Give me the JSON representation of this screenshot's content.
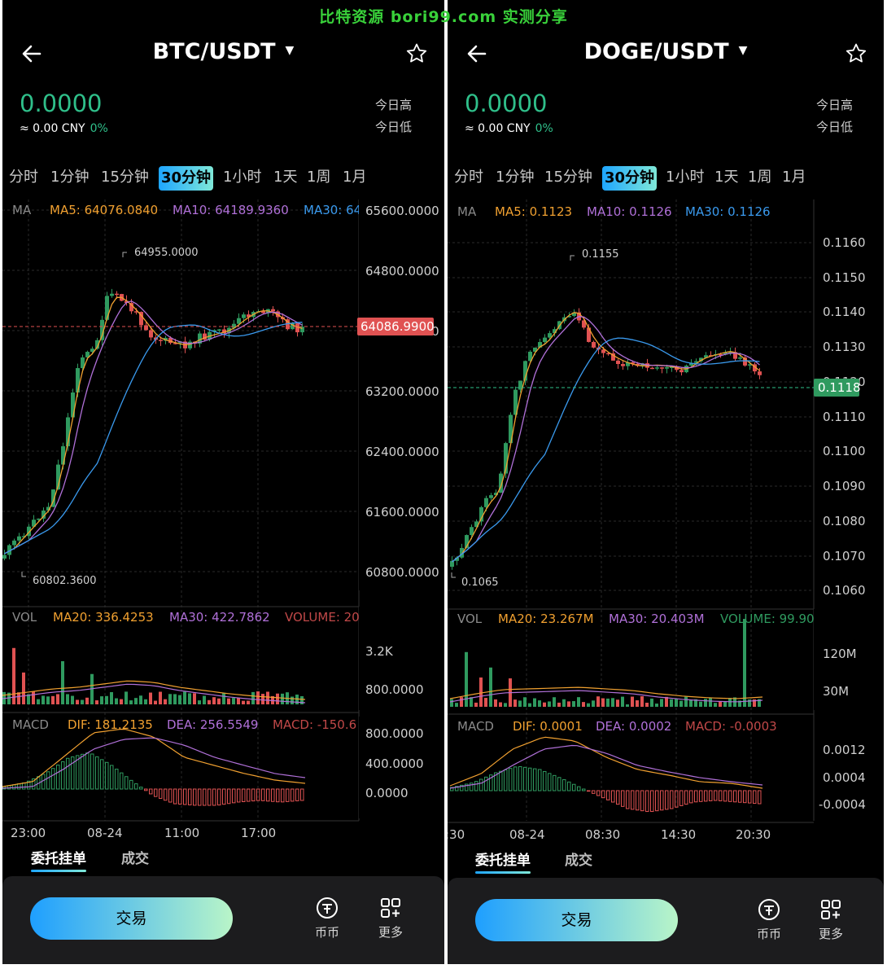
{
  "watermark": "比特资源  bori99.com  实测分享",
  "colors": {
    "up": "#2f9a5f",
    "down": "#e05252",
    "ma5": "#f0a030",
    "ma10": "#b070d8",
    "ma30": "#3a9aee",
    "accent": "#2fbf8a",
    "background": "#000000"
  },
  "panels": [
    {
      "pair": "BTC/USDT",
      "price": "0.0000",
      "cny": "≈ 0.00 CNY",
      "change": "0%",
      "today_high": "今日高",
      "today_low": "今日低",
      "timeframes": [
        "分时",
        "1分钟",
        "15分钟",
        "30分钟",
        "1小时",
        "1天",
        "1周",
        "1月"
      ],
      "active_timeframe": "30分钟",
      "ma_label": "MA",
      "ma5": "MA5: 64076.0840",
      "ma10": "MA10: 64189.9360",
      "ma30": "MA30: 64",
      "y_ticks": [
        "65600.0000",
        "64800.0000",
        "64000.0000",
        "63200.0000",
        "62400.0000",
        "61600.0000",
        "60800.0000"
      ],
      "current_price_label": "64086.9900",
      "max_label": "64955.0000",
      "min_label": "60802.3600",
      "vol_label": "VOL",
      "vol_ma20": "MA20: 336.4253",
      "vol_ma30": "MA30: 422.7862",
      "vol_volume": "VOLUME: 20",
      "vol_ticks": [
        "3.2K",
        "800.0000"
      ],
      "macd_label": "MACD",
      "dif": "DIF: 181.2135",
      "dea": "DEA: 256.5549",
      "macd": "MACD: -150.6",
      "macd_ticks": [
        "800.0000",
        "400.0000",
        "0.0000"
      ],
      "x_ticks": [
        "23:00",
        "08-24",
        "11:00",
        "17:00"
      ],
      "order_tab": "委托挂单",
      "deal_tab": "成交",
      "trade_button": "交易",
      "coin_label": "币币",
      "more_label": "更多"
    },
    {
      "pair": "DOGE/USDT",
      "price": "0.0000",
      "cny": "≈ 0.00 CNY",
      "change": "0%",
      "today_high": "今日高",
      "today_low": "今日低",
      "timeframes": [
        "分时",
        "1分钟",
        "15分钟",
        "30分钟",
        "1小时",
        "1天",
        "1周",
        "1月"
      ],
      "active_timeframe": "30分钟",
      "ma_label": "MA",
      "ma5": "MA5: 0.1123",
      "ma10": "MA10: 0.1126",
      "ma30": "MA30: 0.1126",
      "y_ticks": [
        "0.1160",
        "0.1150",
        "0.1140",
        "0.1130",
        "0.1120",
        "0.1110",
        "0.1100",
        "0.1090",
        "0.1080",
        "0.1070",
        "0.1060"
      ],
      "current_price_label": "0.1118",
      "max_label": "0.1155",
      "min_label": "0.1065",
      "vol_label": "VOL",
      "vol_ma20": "MA20: 23.267M",
      "vol_ma30": "MA30: 20.403M",
      "vol_volume": "VOLUME: 99.90",
      "vol_ticks": [
        "120M",
        "30M"
      ],
      "macd_label": "MACD",
      "dif": "DIF: 0.0001",
      "dea": "DEA: 0.0002",
      "macd": "MACD: -0.0003",
      "macd_ticks": [
        "0.0012",
        "0.0004",
        "-0.0004"
      ],
      "x_ticks": [
        ":30",
        "08-24",
        "08:30",
        "14:30",
        "20:30"
      ],
      "order_tab": "委托挂单",
      "deal_tab": "成交",
      "trade_button": "交易",
      "coin_label": "币币",
      "more_label": "更多"
    }
  ]
}
